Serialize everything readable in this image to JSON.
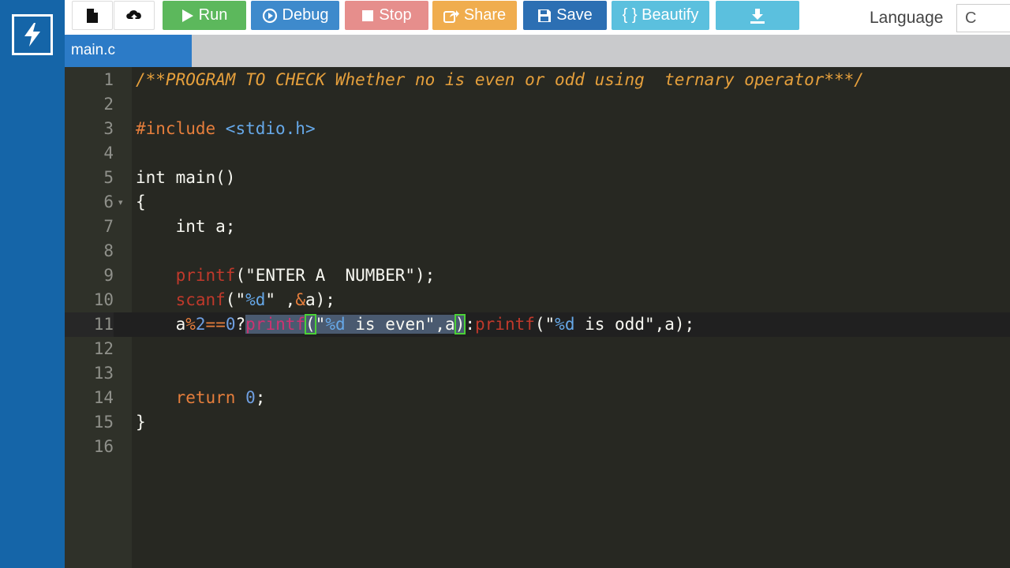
{
  "toolbar": {
    "new_icon": "file-icon",
    "upload_icon": "cloud-upload-icon",
    "run_label": "Run",
    "debug_label": "Debug",
    "stop_label": "Stop",
    "share_label": "Share",
    "save_label": "Save",
    "beautify_label": "{ } Beautify",
    "download_icon": "download-icon",
    "language_label": "Language",
    "language_value": "C"
  },
  "tab": {
    "name": "main.c"
  },
  "editor": {
    "line_numbers": [
      "1",
      "2",
      "3",
      "4",
      "5",
      "6",
      "7",
      "8",
      "9",
      "10",
      "11",
      "12",
      "13",
      "14",
      "15",
      "16"
    ],
    "active_line": 11,
    "lines": {
      "l1": "/**PROGRAM TO CHECK Whether no is even or odd using  ternary operator***/",
      "l3_pre": "#include ",
      "l3_inc": "<stdio.h>",
      "l5": "int main()",
      "l6": "{",
      "l7": "    int a;",
      "l9_fn": "printf",
      "l9_rest": "(\"ENTER A  NUMBER\");",
      "l10_fn": "scanf",
      "l10_p1": "(\"",
      "l10_fmt": "%d",
      "l10_p2": "\" ,",
      "l10_amp": "&",
      "l10_p3": "a);",
      "l11_a": "a",
      "l11_op": "%",
      "l11_two": "2",
      "l11_eq": "==",
      "l11_zero": "0",
      "l11_q": "?",
      "l11_fn1": "printf",
      "l11_open": "(",
      "l11_q1": "\"",
      "l11_fmt1": "%d",
      "l11_s1": " is even\",a",
      "l11_close": ")",
      "l11_colon": ":",
      "l11_fn2": "printf",
      "l11_p2": "(\"",
      "l11_fmt2": "%d",
      "l11_s2": " is odd\",a);",
      "l14_ret": "return",
      "l14_zero": "0",
      "l14_semi": ";",
      "l15": "}"
    }
  },
  "colors": {
    "sidebar": "#1565a8",
    "editor_bg": "#272822",
    "gutter_bg": "#2f3129",
    "run": "#5cb85c",
    "debug": "#3e8acc",
    "stop": "#d9534f",
    "share": "#f0ad4e",
    "save": "#2c6fb3",
    "beautify": "#5bc0de"
  }
}
